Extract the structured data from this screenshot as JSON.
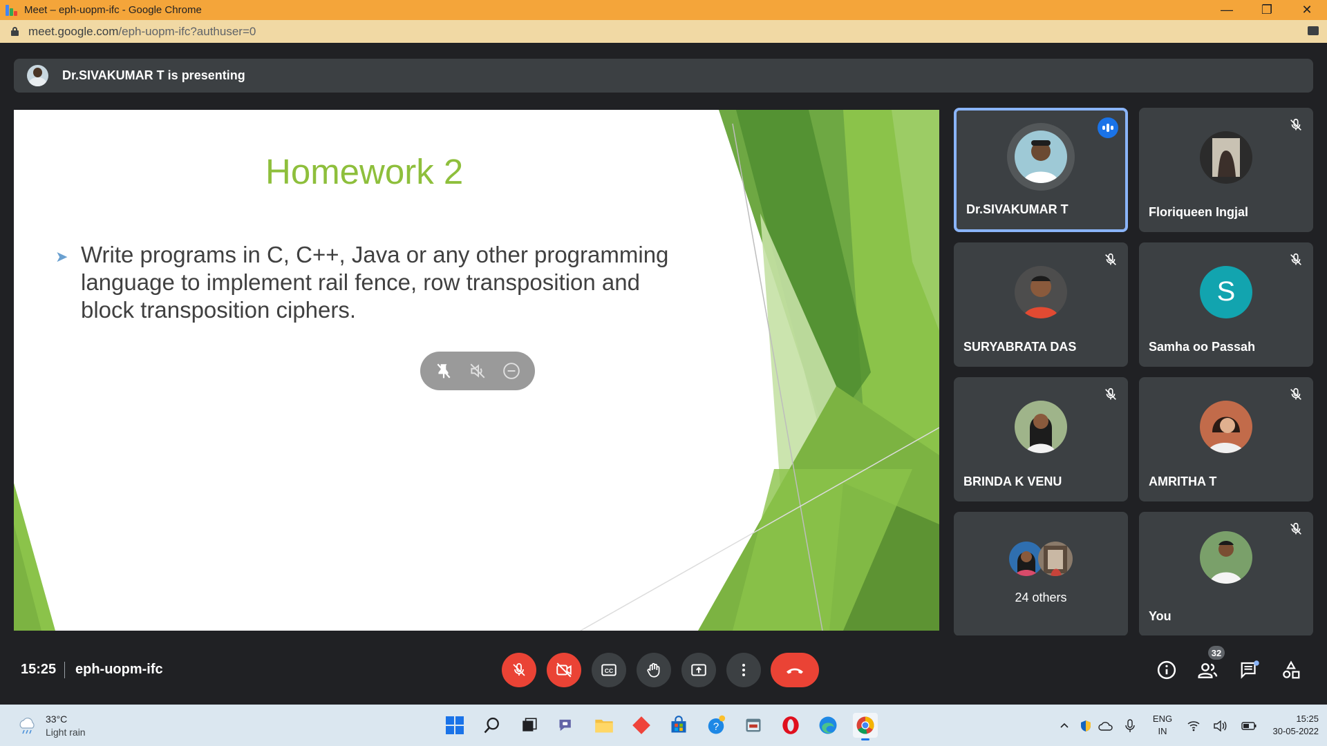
{
  "window": {
    "title": "Meet – eph-uopm-ifc - Google Chrome",
    "url_host": "meet.google.com",
    "url_path": "/eph-uopm-ifc?authuser=0"
  },
  "banner": {
    "text": "Dr.SIVAKUMAR T is presenting"
  },
  "slide": {
    "title": "Homework 2",
    "bullet": "Write programs in C, C++, Java or any other programming language to implement rail fence, row transposition and block transposition ciphers."
  },
  "participants": [
    {
      "name": "Dr.SIVAKUMAR T",
      "status": "speaking"
    },
    {
      "name": "Floriqueen Ingjal",
      "status": "muted"
    },
    {
      "name": "SURYABRATA DAS",
      "status": "muted"
    },
    {
      "name": "Samha oo Passah",
      "status": "muted",
      "initial": "S"
    },
    {
      "name": "BRINDA K VENU",
      "status": "muted"
    },
    {
      "name": "AMRITHA T",
      "status": "muted"
    },
    {
      "name": "24 others"
    },
    {
      "name": "You",
      "status": "muted"
    }
  ],
  "controls": {
    "time": "15:25",
    "meeting_code": "eph-uopm-ifc",
    "people_count": "32"
  },
  "taskbar": {
    "temperature": "33°C",
    "weather": "Light rain",
    "lang_1": "ENG",
    "lang_2": "IN",
    "time": "15:25",
    "date": "30-05-2022"
  },
  "colors": {
    "title_bar": "#f4a53a",
    "slide_title": "#8ebf3c",
    "end_call": "#ea4335",
    "active_tile_border": "#8ab4f8",
    "speaking_badge": "#1a73e8"
  }
}
